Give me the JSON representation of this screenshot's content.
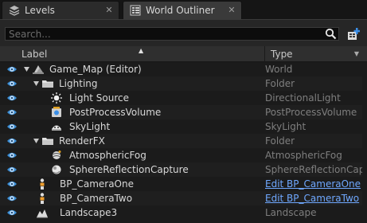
{
  "tabs": [
    {
      "label": "Levels",
      "icon": "levels-icon",
      "active": false
    },
    {
      "label": "World Outliner",
      "icon": "world-outliner-icon",
      "active": true
    }
  ],
  "toolbar": {
    "search_placeholder": "Search...",
    "search_value": ""
  },
  "columns": {
    "label": "Label",
    "type": "Type"
  },
  "rows": [
    {
      "label": "Game_Map (Editor)",
      "type": "World",
      "type_link": false,
      "depth": 0,
      "icon": "world-icon",
      "expand": "expanded"
    },
    {
      "label": "Lighting",
      "type": "Folder",
      "type_link": false,
      "depth": 1,
      "icon": "folder-icon",
      "expand": "expanded"
    },
    {
      "label": "Light Source",
      "type": "DirectionalLight",
      "type_link": false,
      "depth": 2,
      "icon": "directional-light-icon",
      "expand": "none"
    },
    {
      "label": "PostProcessVolume",
      "type": "PostProcessVolume",
      "type_link": false,
      "depth": 2,
      "icon": "post-process-volume-icon",
      "expand": "none"
    },
    {
      "label": "SkyLight",
      "type": "SkyLight",
      "type_link": false,
      "depth": 2,
      "icon": "skylight-icon",
      "expand": "none"
    },
    {
      "label": "RenderFX",
      "type": "Folder",
      "type_link": false,
      "depth": 1,
      "icon": "folder-icon",
      "expand": "expanded"
    },
    {
      "label": "AtmosphericFog",
      "type": "AtmosphericFog",
      "type_link": false,
      "depth": 2,
      "icon": "atmospheric-fog-icon",
      "expand": "none"
    },
    {
      "label": "SphereReflectionCapture",
      "type": "SphereReflectionCaptu",
      "type_link": false,
      "depth": 2,
      "icon": "sphere-reflection-capture-icon",
      "expand": "none"
    },
    {
      "label": "BP_CameraOne",
      "type": "Edit BP_CameraOne",
      "type_link": true,
      "depth": 1,
      "icon": "blueprint-actor-icon",
      "expand": "none"
    },
    {
      "label": "BP_CameraTwo",
      "type": "Edit BP_CameraTwo",
      "type_link": true,
      "depth": 1,
      "icon": "blueprint-actor-icon",
      "expand": "none"
    },
    {
      "label": "Landscape3",
      "type": "Landscape",
      "type_link": false,
      "depth": 1,
      "icon": "landscape-icon",
      "expand": "none"
    }
  ],
  "colors": {
    "background": "#1b1b1b",
    "link": "#6fa8ff",
    "text": "#d8d8d8",
    "type_text": "#7e7e7e",
    "eye": "#4aa3e8"
  }
}
